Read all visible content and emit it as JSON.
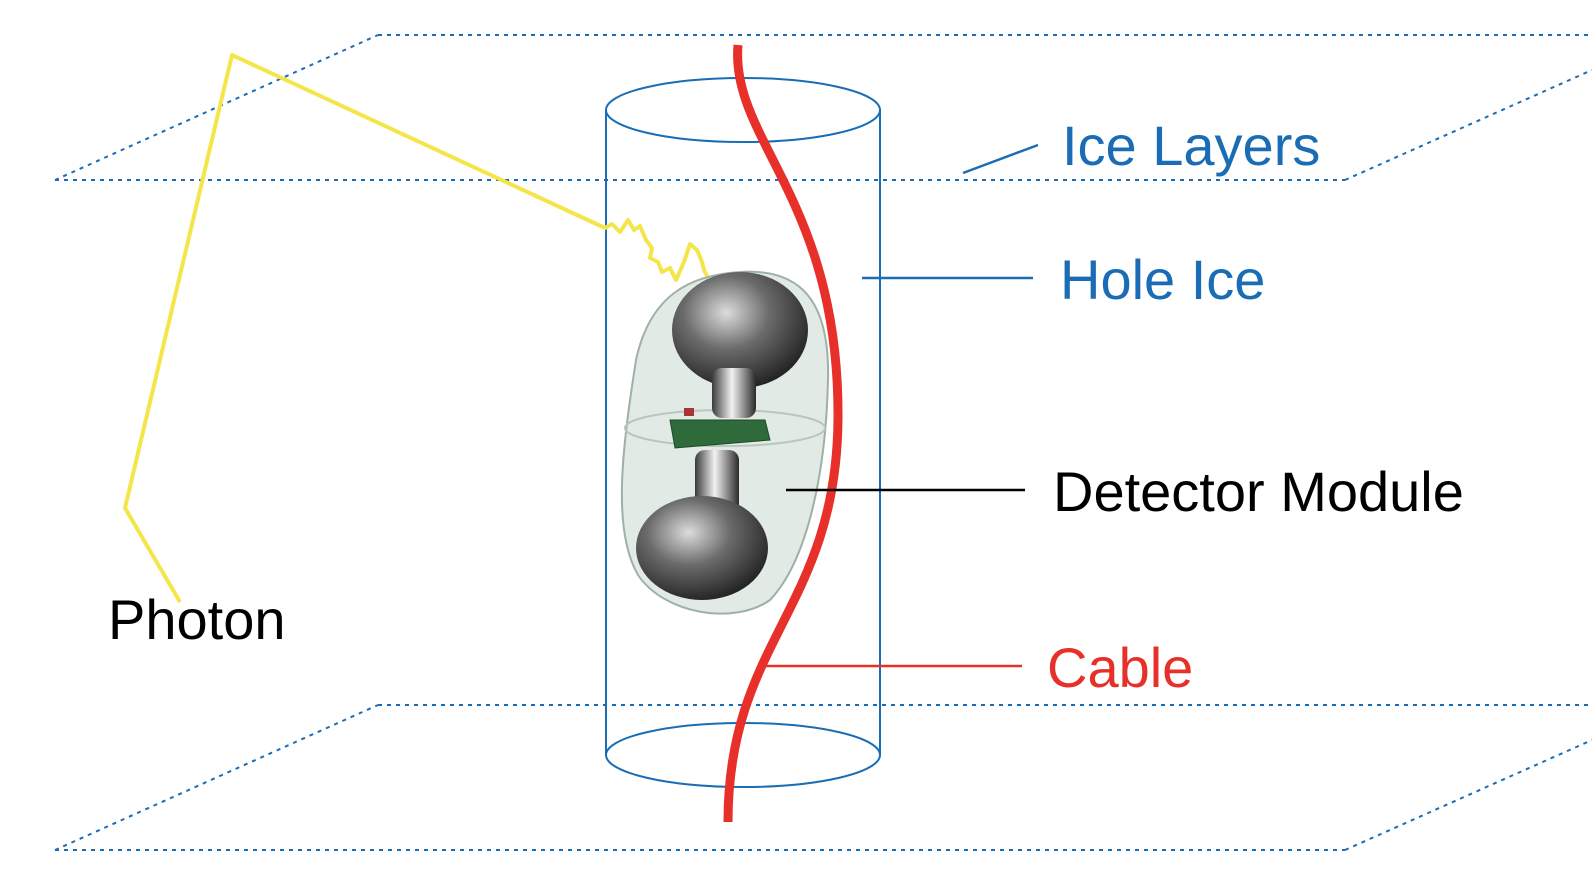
{
  "labels": {
    "ice_layers": "Ice Layers",
    "hole_ice": "Hole Ice",
    "detector_module": "Detector Module",
    "cable": "Cable",
    "photon": "Photon"
  },
  "colors": {
    "ice": "#1a6db5",
    "cable": "#e8302a",
    "photon": "#f4e64a",
    "text_dark": "#000000",
    "module_glass": "#c9d9cf",
    "module_board": "#2f6b3a"
  }
}
